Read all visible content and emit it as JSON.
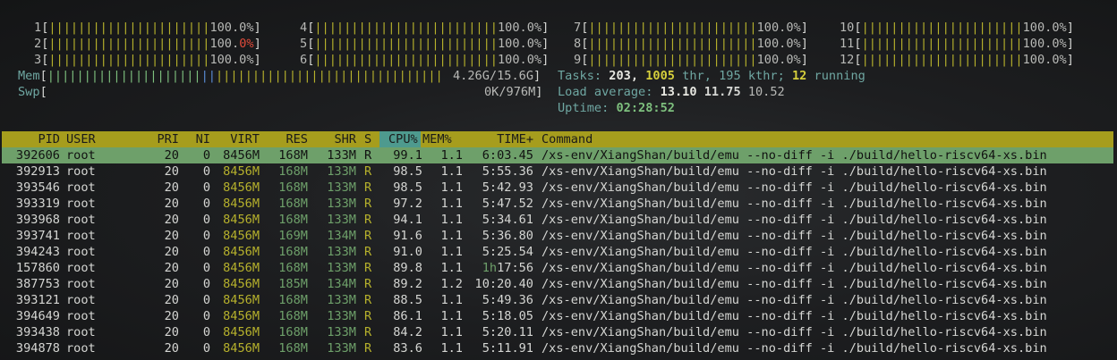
{
  "cpu_meters": [
    {
      "id": "1",
      "pct": "100.0%",
      "red": false
    },
    {
      "id": "2",
      "pct_pre": "100.",
      "pct_red": "0%",
      "red": true
    },
    {
      "id": "3",
      "pct": "100.0%",
      "red": false
    },
    {
      "id": "4",
      "pct": "100.0%"
    },
    {
      "id": "5",
      "pct": "100.0%"
    },
    {
      "id": "6",
      "pct": "100.0%"
    },
    {
      "id": "7",
      "pct": "100.0%"
    },
    {
      "id": "8",
      "pct": "100.0%"
    },
    {
      "id": "9",
      "pct": "100.0%"
    },
    {
      "id": "10",
      "pct": "100.0%"
    },
    {
      "id": "11",
      "pct": "100.0%"
    },
    {
      "id": "12",
      "pct": "100.0%"
    }
  ],
  "bars": {
    "b1": "||||||||||||||||||||||",
    "b4": "|||||||||||||||||||||||||",
    "b7": "|||||||||||||||||||||||",
    "b10": "||||||||||||||||||||||",
    "mem_green": "|||||||||||||||||||||",
    "mem_blue": "||",
    "mem_yellow": "|||||||||||||||||||||||||||||||"
  },
  "memory": {
    "label": "Mem",
    "value": "4.26G/15.6G"
  },
  "swap": {
    "label": "Swp",
    "value": "0K/976M"
  },
  "tasks": {
    "label": "Tasks:",
    "count": "203,",
    "thr": "1005",
    "thr_label": "thr,",
    "kthr": "195",
    "kthr_label": "kthr;",
    "running": "12",
    "running_label": "running"
  },
  "load": {
    "label": "Load average:",
    "l1": "13.10",
    "l5": "11.75",
    "l15": "10.52"
  },
  "uptime": {
    "label": "Uptime:",
    "value": "02:28:52"
  },
  "columns": {
    "pid": "PID",
    "user": "USER",
    "pri": "PRI",
    "ni": "NI",
    "virt": "VIRT",
    "res": "RES",
    "shr": "SHR",
    "s": "S",
    "cpu": "CPU%",
    "mem": "MEM%",
    "time": "TIME+",
    "cmd": "Command"
  },
  "processes": [
    {
      "pid": "392606",
      "user": "root",
      "pri": "20",
      "ni": "0",
      "virt": "8456M",
      "res": "168M",
      "shr": "133M",
      "s": "R",
      "cpu": "99.1",
      "mem": "1.1",
      "time": "6:03.45",
      "cmd": "/xs-env/XiangShan/build/emu --no-diff -i ./build/hello-riscv64-xs.bin"
    },
    {
      "pid": "392913",
      "user": "root",
      "pri": "20",
      "ni": "0",
      "virt": "8456M",
      "res": "168M",
      "shr": "133M",
      "s": "R",
      "cpu": "98.5",
      "mem": "1.1",
      "time": "5:55.36",
      "cmd": "/xs-env/XiangShan/build/emu --no-diff -i ./build/hello-riscv64-xs.bin"
    },
    {
      "pid": "393546",
      "user": "root",
      "pri": "20",
      "ni": "0",
      "virt": "8456M",
      "res": "168M",
      "shr": "133M",
      "s": "R",
      "cpu": "98.5",
      "mem": "1.1",
      "time": "5:42.93",
      "cmd": "/xs-env/XiangShan/build/emu --no-diff -i ./build/hello-riscv64-xs.bin"
    },
    {
      "pid": "393319",
      "user": "root",
      "pri": "20",
      "ni": "0",
      "virt": "8456M",
      "res": "168M",
      "shr": "133M",
      "s": "R",
      "cpu": "97.2",
      "mem": "1.1",
      "time": "5:47.52",
      "cmd": "/xs-env/XiangShan/build/emu --no-diff -i ./build/hello-riscv64-xs.bin"
    },
    {
      "pid": "393968",
      "user": "root",
      "pri": "20",
      "ni": "0",
      "virt": "8456M",
      "res": "168M",
      "shr": "133M",
      "s": "R",
      "cpu": "94.1",
      "mem": "1.1",
      "time": "5:34.61",
      "cmd": "/xs-env/XiangShan/build/emu --no-diff -i ./build/hello-riscv64-xs.bin"
    },
    {
      "pid": "393741",
      "user": "root",
      "pri": "20",
      "ni": "0",
      "virt": "8456M",
      "res": "169M",
      "shr": "134M",
      "s": "R",
      "cpu": "91.6",
      "mem": "1.1",
      "time": "5:36.80",
      "cmd": "/xs-env/XiangShan/build/emu --no-diff -i ./build/hello-riscv64-xs.bin"
    },
    {
      "pid": "394243",
      "user": "root",
      "pri": "20",
      "ni": "0",
      "virt": "8456M",
      "res": "168M",
      "shr": "133M",
      "s": "R",
      "cpu": "91.0",
      "mem": "1.1",
      "time": "5:25.54",
      "cmd": "/xs-env/XiangShan/build/emu --no-diff -i ./build/hello-riscv64-xs.bin"
    },
    {
      "pid": "157860",
      "user": "root",
      "pri": "20",
      "ni": "0",
      "virt": "8456M",
      "res": "168M",
      "shr": "133M",
      "s": "R",
      "cpu": "89.8",
      "mem": "1.1",
      "time_h": "1h",
      "time": "17:56",
      "cmd": "/xs-env/XiangShan/build/emu --no-diff -i ./build/hello-riscv64-xs.bin"
    },
    {
      "pid": "387753",
      "user": "root",
      "pri": "20",
      "ni": "0",
      "virt": "8456M",
      "res": "185M",
      "shr": "134M",
      "s": "R",
      "cpu": "89.2",
      "mem": "1.2",
      "time": "10:20.40",
      "cmd": "/xs-env/XiangShan/build/emu --no-diff -i ./build/hello-riscv64-xs.bin"
    },
    {
      "pid": "393121",
      "user": "root",
      "pri": "20",
      "ni": "0",
      "virt": "8456M",
      "res": "168M",
      "shr": "133M",
      "s": "R",
      "cpu": "88.5",
      "mem": "1.1",
      "time": "5:49.36",
      "cmd": "/xs-env/XiangShan/build/emu --no-diff -i ./build/hello-riscv64-xs.bin"
    },
    {
      "pid": "394649",
      "user": "root",
      "pri": "20",
      "ni": "0",
      "virt": "8456M",
      "res": "168M",
      "shr": "133M",
      "s": "R",
      "cpu": "86.1",
      "mem": "1.1",
      "time": "5:18.05",
      "cmd": "/xs-env/XiangShan/build/emu --no-diff -i ./build/hello-riscv64-xs.bin"
    },
    {
      "pid": "393438",
      "user": "root",
      "pri": "20",
      "ni": "0",
      "virt": "8456M",
      "res": "168M",
      "shr": "133M",
      "s": "R",
      "cpu": "84.2",
      "mem": "1.1",
      "time": "5:20.11",
      "cmd": "/xs-env/XiangShan/build/emu --no-diff -i ./build/hello-riscv64-xs.bin"
    },
    {
      "pid": "394878",
      "user": "root",
      "pri": "20",
      "ni": "0",
      "virt": "8456M",
      "res": "168M",
      "shr": "133M",
      "s": "R",
      "cpu": "83.6",
      "mem": "1.1",
      "time": "5:11.91",
      "cmd": "/xs-env/XiangShan/build/emu --no-diff -i ./build/hello-riscv64-xs.bin"
    }
  ]
}
